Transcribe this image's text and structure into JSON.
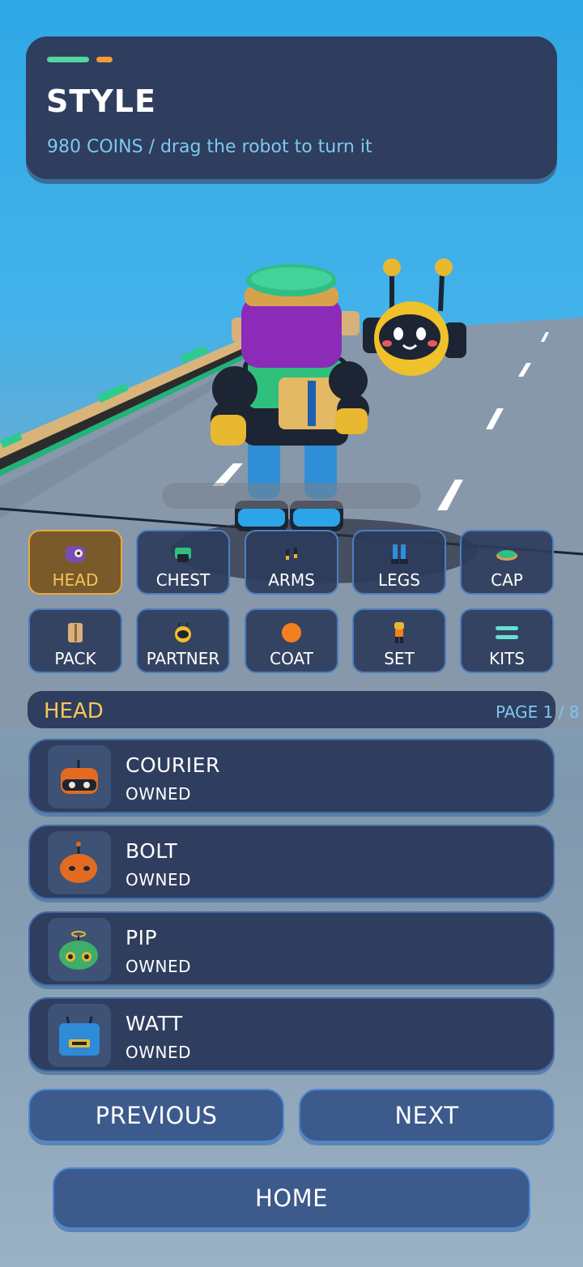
{
  "header": {
    "title": "STYLE",
    "subtitle": "980 COINS / drag the robot to turn it"
  },
  "categories": [
    {
      "label": "HEAD",
      "icon": "head-icon",
      "active": true
    },
    {
      "label": "CHEST",
      "icon": "chest-icon"
    },
    {
      "label": "ARMS",
      "icon": "arms-icon"
    },
    {
      "label": "LEGS",
      "icon": "legs-icon"
    },
    {
      "label": "CAP",
      "icon": "cap-icon"
    },
    {
      "label": "PACK",
      "icon": "pack-icon"
    },
    {
      "label": "PARTNER",
      "icon": "partner-icon"
    },
    {
      "label": "COAT",
      "icon": "coat-icon"
    },
    {
      "label": "SET",
      "icon": "set-icon"
    },
    {
      "label": "KITS",
      "icon": "kits-icon"
    }
  ],
  "list": {
    "section": "HEAD",
    "page": "PAGE 1 / 8",
    "items": [
      {
        "name": "COURIER",
        "status": "OWNED",
        "icon": "courier-head-icon"
      },
      {
        "name": "BOLT",
        "status": "OWNED",
        "icon": "bolt-head-icon"
      },
      {
        "name": "PIP",
        "status": "OWNED",
        "icon": "pip-head-icon"
      },
      {
        "name": "WATT",
        "status": "OWNED",
        "icon": "watt-head-icon"
      }
    ]
  },
  "nav": {
    "previous": "PREVIOUS",
    "next": "NEXT",
    "home": "HOME"
  },
  "colors": {
    "panel": "#2f3d5e",
    "accent_gold": "#f6c75a",
    "accent_cyan": "#7cc9ee",
    "active_tab": "#7a5a2a"
  }
}
